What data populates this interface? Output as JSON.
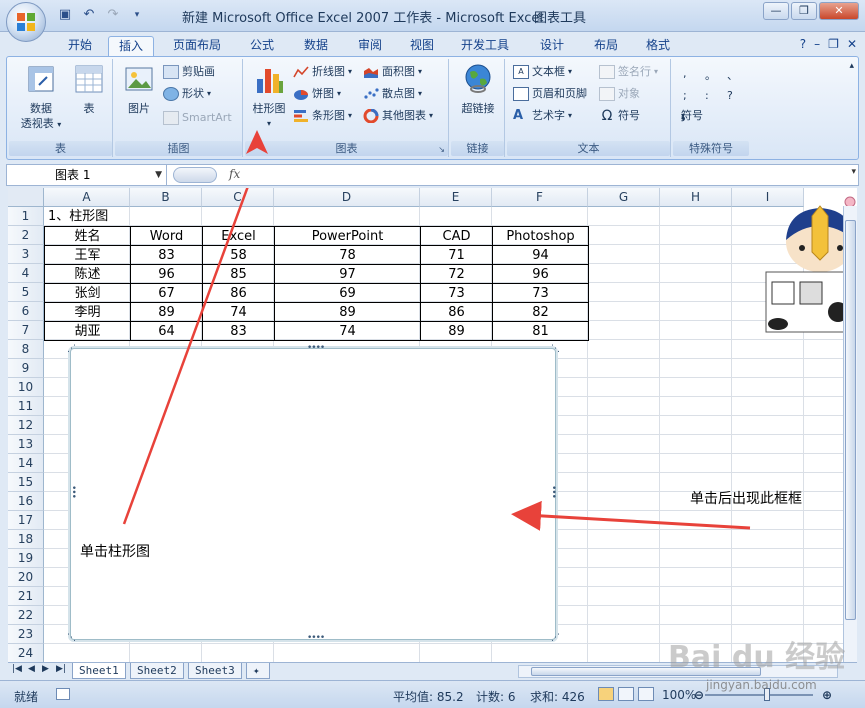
{
  "window": {
    "title": "新建 Microsoft Office Excel 2007 工作表 - Microsoft Excel",
    "contextual_title": "图表工具",
    "controls": [
      "—",
      "❐",
      "✕"
    ]
  },
  "tabs": [
    "开始",
    "插入",
    "页面布局",
    "公式",
    "数据",
    "审阅",
    "视图",
    "开发工具",
    "设计",
    "布局",
    "格式"
  ],
  "active_tab": "插入",
  "ribbon": {
    "groups": {
      "table": "表",
      "illustrations": "插图",
      "charts": "图表",
      "links": "链接",
      "text": "文本",
      "symbols": "特殊符号"
    },
    "pivot_line1": "数据",
    "pivot_line2": "透视表",
    "table_btn": "表",
    "picture_btn": "图片",
    "clipart_btn": "剪贴画",
    "shapes_btn": "形状",
    "smartart_btn": "SmartArt",
    "column_chart_btn": "柱形图",
    "line_chart_btn": "折线图",
    "pie_chart_btn": "饼图",
    "bar_chart_btn": "条形图",
    "area_chart_btn": "面积图",
    "scatter_chart_btn": "散点图",
    "other_chart_btn": "其他图表",
    "hyperlink_btn": "超链接",
    "textbox_btn": "文本框",
    "header_footer_btn": "页眉和页脚",
    "wordart_btn": "艺术字",
    "signature_btn": "签名行",
    "object_btn": "对象",
    "symbol_btn": "符号",
    "special_symbol_btn": "符号",
    "special_chars": [
      ",",
      "。",
      "、",
      ";",
      ":",
      "?"
    ]
  },
  "formula_bar": {
    "name_box": "图表 1",
    "fx": "fx"
  },
  "columns": [
    "A",
    "B",
    "C",
    "D",
    "E",
    "F",
    "G",
    "H",
    "I"
  ],
  "rows": [
    "1",
    "2",
    "3",
    "4",
    "5",
    "6",
    "7",
    "8",
    "9",
    "10",
    "11",
    "12",
    "13",
    "14",
    "15",
    "16",
    "17",
    "18",
    "19",
    "20",
    "21",
    "22",
    "23",
    "24"
  ],
  "cells": {
    "title": "1、柱形图"
  },
  "table": {
    "headers": [
      "姓名",
      "Word",
      "Excel",
      "PowerPoint",
      "CAD",
      "Photoshop"
    ],
    "rows": [
      [
        "王军",
        "83",
        "58",
        "78",
        "71",
        "94"
      ],
      [
        "陈述",
        "96",
        "85",
        "97",
        "72",
        "96"
      ],
      [
        "张剑",
        "67",
        "86",
        "69",
        "73",
        "73"
      ],
      [
        "李明",
        "89",
        "74",
        "89",
        "86",
        "82"
      ],
      [
        "胡亚",
        "64",
        "83",
        "74",
        "89",
        "81"
      ]
    ]
  },
  "annotations": {
    "click_column_chart": "单击柱形图",
    "frame_appears": "单击后出现此框框"
  },
  "sheet_tabs": [
    "Sheet1",
    "Sheet2",
    "Sheet3"
  ],
  "status": {
    "ready": "就绪",
    "average": "平均值: 85.2",
    "count": "计数: 6",
    "sum": "求和: 426",
    "zoom": "100%"
  },
  "watermark": {
    "brand": "Bai du 经验",
    "url": "jingyan.baidu.com"
  },
  "colors": {
    "ribbon_bg": "#dfe9f5",
    "accent": "#15428b",
    "arrow": "#e8423a"
  }
}
